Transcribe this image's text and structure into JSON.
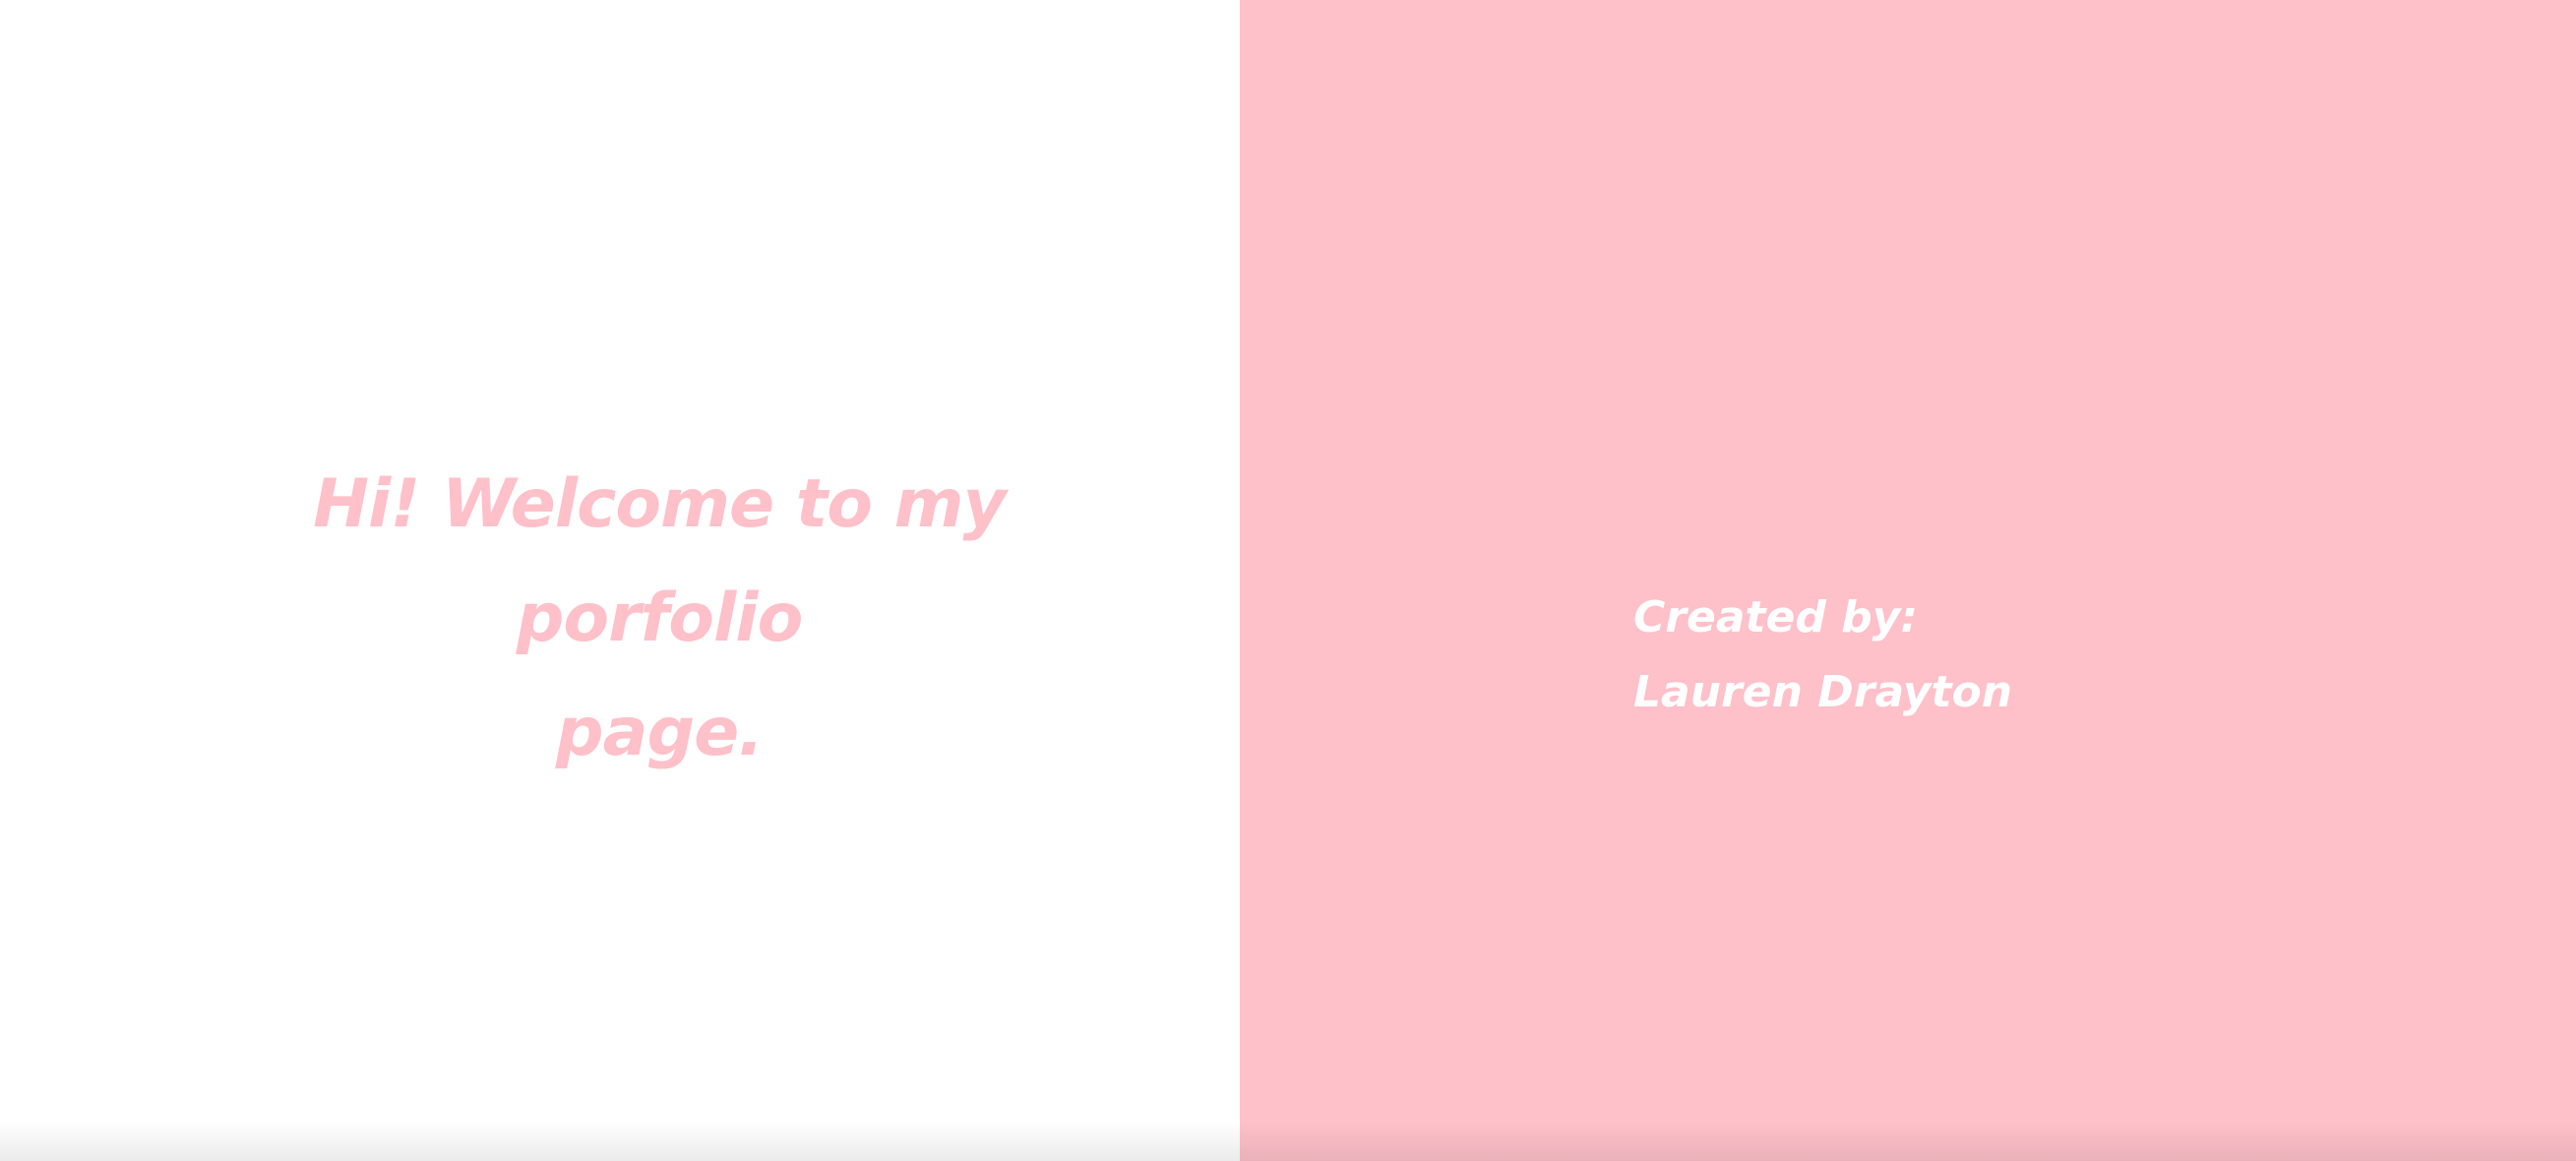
{
  "welcome": {
    "line1": "Hi! Welcome to my",
    "line2": "porfolio",
    "line3": "page."
  },
  "credit": {
    "label": "Created by:",
    "name": "Lauren Drayton"
  },
  "colors": {
    "accent_pink": "#fec0c9",
    "background": "#ffffff",
    "credit_text": "#ffffff"
  }
}
